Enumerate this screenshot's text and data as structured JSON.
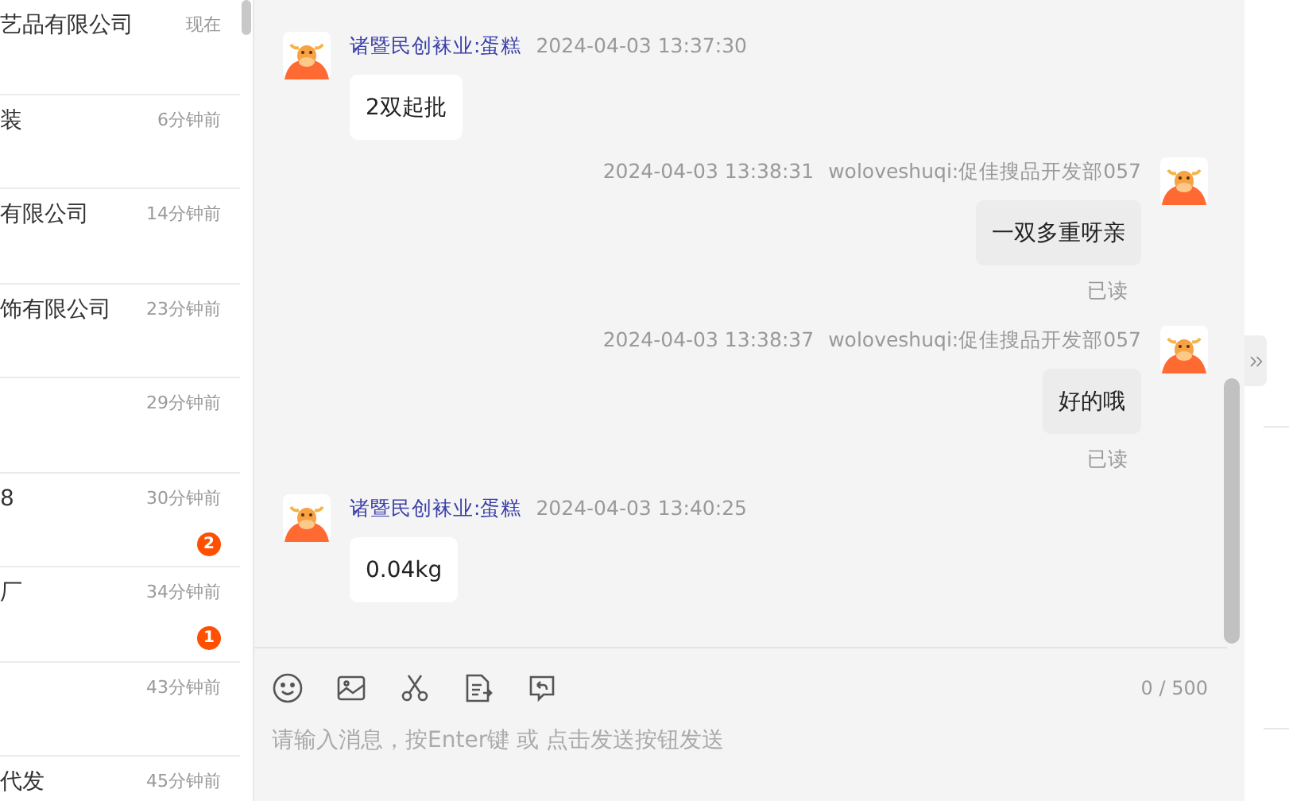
{
  "conversations": [
    {
      "title": "艺品有限公司",
      "time": "现在"
    },
    {
      "title": "装",
      "time": "6分钟前"
    },
    {
      "title": "有限公司",
      "time": "14分钟前"
    },
    {
      "title": "饰有限公司",
      "time": "23分钟前"
    },
    {
      "time": "29分钟前"
    },
    {
      "title": "8",
      "time": "30分钟前",
      "unread": "2"
    },
    {
      "title": "厂",
      "time": "34分钟前",
      "unread": "1"
    },
    {
      "time": "43分钟前"
    },
    {
      "title": "代发",
      "time": "45分钟前"
    }
  ],
  "messages": [
    {
      "kind": "incoming",
      "sender": "诸暨民创袜业:蛋糕",
      "time": "2024-04-03 13:37:30",
      "text": "2双起批"
    },
    {
      "kind": "outgoing",
      "sender": "woloveshuqi:促佳搜品开发部057",
      "time": "2024-04-03 13:38:31",
      "text": "一双多重呀亲",
      "status": "已读"
    },
    {
      "kind": "outgoing",
      "sender": "woloveshuqi:促佳搜品开发部057",
      "time": "2024-04-03 13:38:37",
      "text": "好的哦",
      "status": "已读"
    },
    {
      "kind": "incoming",
      "sender": "诸暨民创袜业:蛋糕",
      "time": "2024-04-03 13:40:25",
      "text": "0.04kg"
    }
  ],
  "composer": {
    "counter": "0 / 500",
    "placeholder": "请输入消息，按Enter键 或 点击发送按钮发送"
  }
}
